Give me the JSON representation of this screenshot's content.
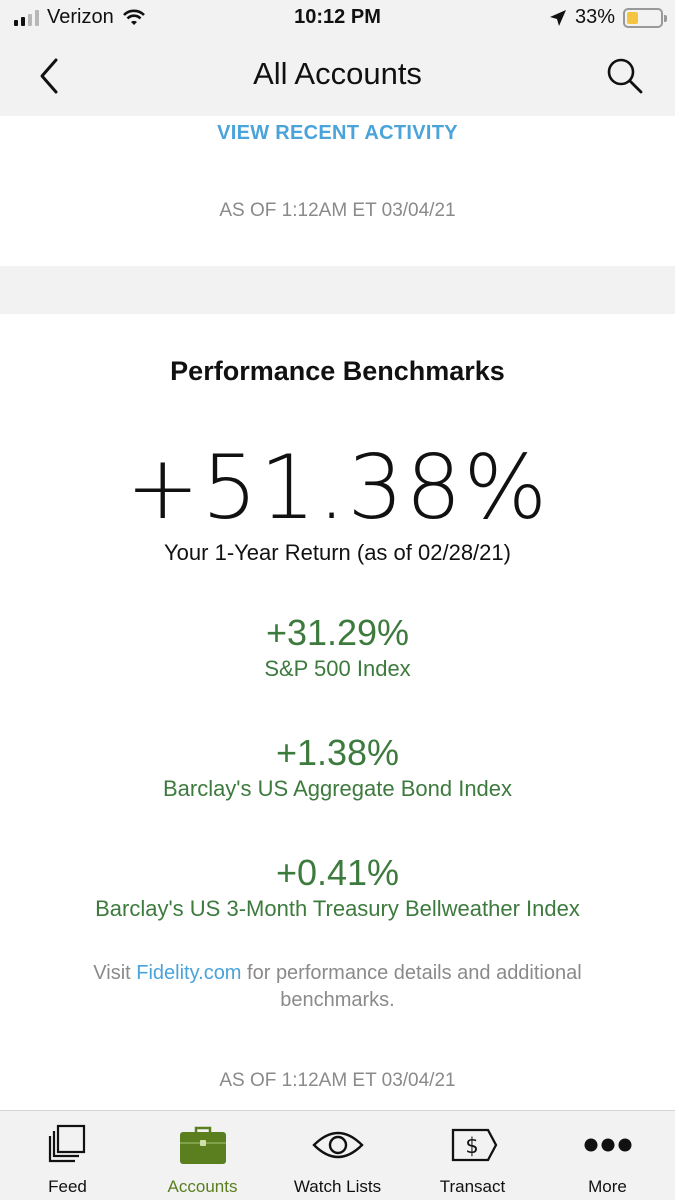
{
  "status_bar": {
    "carrier": "Verizon",
    "time": "10:12 PM",
    "battery_percent": "33%",
    "battery_level": 0.33
  },
  "header": {
    "title": "All Accounts",
    "back_icon": "chevron-left-icon",
    "search_icon": "search-icon"
  },
  "activity": {
    "link_label": "VIEW RECENT ACTIVITY",
    "as_of": "AS OF 1:12AM ET 03/04/21"
  },
  "performance": {
    "title": "Performance Benchmarks",
    "your_return": "+51.38%",
    "your_return_label": "Your 1-Year Return (as of 02/28/21)",
    "benchmarks": [
      {
        "pct": "+31.29%",
        "name": "S&P 500 Index"
      },
      {
        "pct": "+1.38%",
        "name": "Barclay's US Aggregate Bond Index"
      },
      {
        "pct": "+0.41%",
        "name": "Barclay's US 3-Month Treasury Bellweather Index"
      }
    ],
    "visit_prefix": "Visit ",
    "visit_link": "Fidelity.com",
    "visit_suffix": " for performance details and additional benchmarks.",
    "as_of": "AS OF 1:12AM ET 03/04/21"
  },
  "tabs": [
    {
      "label": "Feed",
      "icon": "feed-icon",
      "active": false
    },
    {
      "label": "Accounts",
      "icon": "briefcase-icon",
      "active": true
    },
    {
      "label": "Watch Lists",
      "icon": "eye-icon",
      "active": false
    },
    {
      "label": "Transact",
      "icon": "dollar-ticket-icon",
      "active": false
    },
    {
      "label": "More",
      "icon": "more-dots-icon",
      "active": false
    }
  ],
  "colors": {
    "accent_blue": "#4aa3d9",
    "benchmark_green": "#3d7a3d",
    "active_tab_green": "#5b7f1e"
  }
}
